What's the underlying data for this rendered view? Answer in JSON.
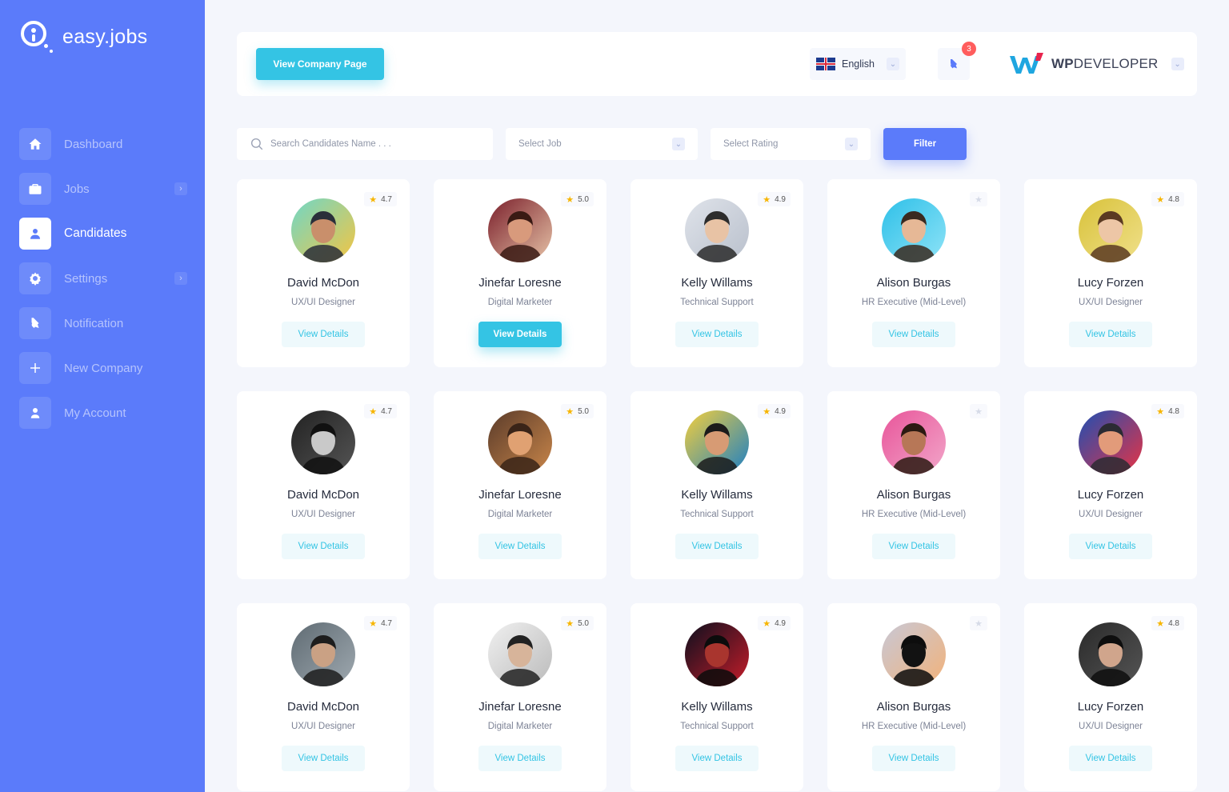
{
  "app": {
    "name": "easy.jobs"
  },
  "sidebar": {
    "items": [
      {
        "label": "Dashboard",
        "icon": "home-icon",
        "active": false,
        "expandable": false
      },
      {
        "label": "Jobs",
        "icon": "briefcase-icon",
        "active": false,
        "expandable": true
      },
      {
        "label": "Candidates",
        "icon": "candidates-icon",
        "active": true,
        "expandable": false
      },
      {
        "label": "Settings",
        "icon": "gear-icon",
        "active": false,
        "expandable": true
      },
      {
        "label": "Notification",
        "icon": "bell-icon",
        "active": false,
        "expandable": false
      },
      {
        "label": "New Company",
        "icon": "plus-icon",
        "active": false,
        "expandable": false
      },
      {
        "label": "My Account",
        "icon": "user-icon",
        "active": false,
        "expandable": false
      }
    ]
  },
  "header": {
    "company_button": "View Company Page",
    "language": "English",
    "notification_count": "3",
    "company_name_bold": "WP",
    "company_name_rest": "DEVELOPER"
  },
  "filters": {
    "search_placeholder": "Search Candidates Name . . .",
    "job_select": "Select Job",
    "rating_select": "Select Rating",
    "filter_button": "Filter"
  },
  "colors": {
    "primary": "#5b7bfa",
    "accent": "#34c4e4",
    "star": "#f7b500",
    "badge": "#ff5d5d"
  },
  "view_details_label": "View Details",
  "candidates": [
    {
      "name": "David McDon",
      "role": "UX/UI Designer",
      "rating": "4.7"
    },
    {
      "name": "Jinefar Loresne",
      "role": "Digital Marketer",
      "rating": "5.0"
    },
    {
      "name": "Kelly Willams",
      "role": "Technical Support",
      "rating": "4.9"
    },
    {
      "name": "Alison Burgas",
      "role": "HR Executive (Mid-Level)",
      "rating": ""
    },
    {
      "name": "Lucy Forzen",
      "role": "UX/UI Designer",
      "rating": "4.8"
    },
    {
      "name": "David McDon",
      "role": "UX/UI Designer",
      "rating": "4.7"
    },
    {
      "name": "Jinefar Loresne",
      "role": "Digital Marketer",
      "rating": "5.0"
    },
    {
      "name": "Kelly Willams",
      "role": "Technical Support",
      "rating": "4.9"
    },
    {
      "name": "Alison Burgas",
      "role": "HR Executive (Mid-Level)",
      "rating": ""
    },
    {
      "name": "Lucy Forzen",
      "role": "UX/UI Designer",
      "rating": "4.8"
    },
    {
      "name": "David McDon",
      "role": "UX/UI Designer",
      "rating": "4.7"
    },
    {
      "name": "Jinefar Loresne",
      "role": "Digital Marketer",
      "rating": "5.0"
    },
    {
      "name": "Kelly Willams",
      "role": "Technical Support",
      "rating": "4.9"
    },
    {
      "name": "Alison Burgas",
      "role": "HR Executive (Mid-Level)",
      "rating": ""
    },
    {
      "name": "Lucy Forzen",
      "role": "UX/UI Designer",
      "rating": "4.8"
    }
  ]
}
